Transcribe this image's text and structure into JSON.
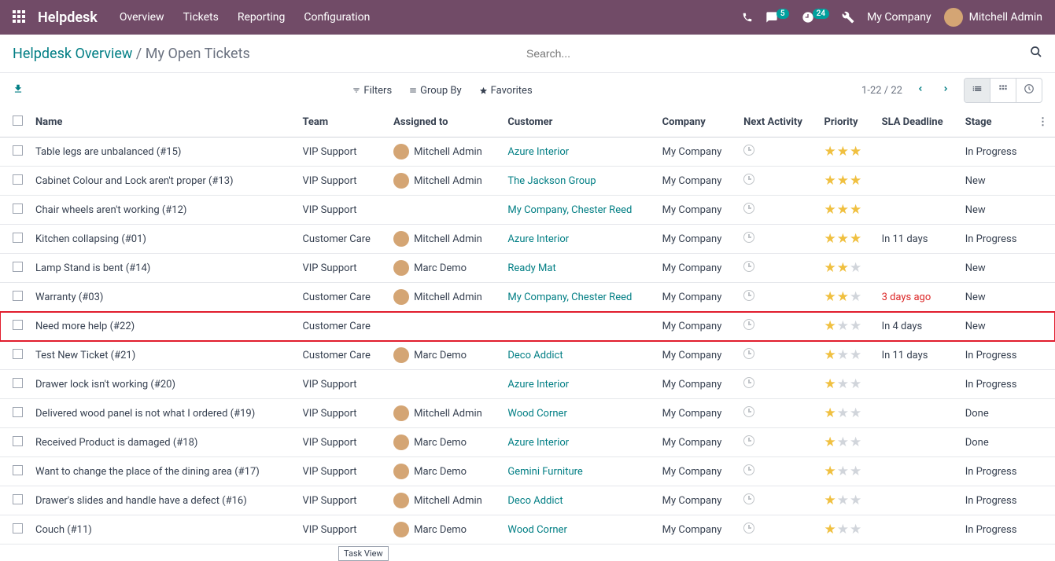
{
  "nav": {
    "brand": "Helpdesk",
    "menu": [
      "Overview",
      "Tickets",
      "Reporting",
      "Configuration"
    ],
    "chat_badge": "5",
    "activity_badge": "24",
    "company": "My Company",
    "user": "Mitchell Admin"
  },
  "breadcrumb": {
    "parent": "Helpdesk Overview",
    "current": "My Open Tickets"
  },
  "search": {
    "placeholder": "Search..."
  },
  "filters": {
    "filters": "Filters",
    "group_by": "Group By",
    "favorites": "Favorites"
  },
  "pager": {
    "text": "1-22 / 22"
  },
  "columns": [
    "Name",
    "Team",
    "Assigned to",
    "Customer",
    "Company",
    "Next Activity",
    "Priority",
    "SLA Deadline",
    "Stage"
  ],
  "tooltip": "Task View",
  "rows": [
    {
      "name": "Table legs are unbalanced (#15)",
      "team": "VIP Support",
      "assigned": "Mitchell Admin",
      "has_avatar": true,
      "customer": "Azure Interior",
      "company": "My Company",
      "priority": 3,
      "sla": "",
      "sla_overdue": false,
      "stage": "In Progress",
      "highlight": false
    },
    {
      "name": "Cabinet Colour and Lock aren't proper (#13)",
      "team": "VIP Support",
      "assigned": "Mitchell Admin",
      "has_avatar": true,
      "customer": "The Jackson Group",
      "company": "My Company",
      "priority": 3,
      "sla": "",
      "sla_overdue": false,
      "stage": "New",
      "highlight": false
    },
    {
      "name": "Chair wheels aren't working (#12)",
      "team": "VIP Support",
      "assigned": "",
      "has_avatar": false,
      "customer": "My Company, Chester Reed",
      "company": "My Company",
      "priority": 3,
      "sla": "",
      "sla_overdue": false,
      "stage": "New",
      "highlight": false
    },
    {
      "name": "Kitchen collapsing (#01)",
      "team": "Customer Care",
      "assigned": "Mitchell Admin",
      "has_avatar": true,
      "customer": "Azure Interior",
      "company": "My Company",
      "priority": 3,
      "sla": "In 11 days",
      "sla_overdue": false,
      "stage": "In Progress",
      "highlight": false
    },
    {
      "name": "Lamp Stand is bent (#14)",
      "team": "VIP Support",
      "assigned": "Marc Demo",
      "has_avatar": true,
      "customer": "Ready Mat",
      "company": "My Company",
      "priority": 2,
      "sla": "",
      "sla_overdue": false,
      "stage": "New",
      "highlight": false
    },
    {
      "name": "Warranty (#03)",
      "team": "Customer Care",
      "assigned": "Mitchell Admin",
      "has_avatar": true,
      "customer": "My Company, Chester Reed",
      "company": "My Company",
      "priority": 2,
      "sla": "3 days ago",
      "sla_overdue": true,
      "stage": "New",
      "highlight": false
    },
    {
      "name": "Need more help (#22)",
      "team": "Customer Care",
      "assigned": "",
      "has_avatar": false,
      "customer": "",
      "company": "My Company",
      "priority": 1,
      "sla": "In 4 days",
      "sla_overdue": false,
      "stage": "New",
      "highlight": true
    },
    {
      "name": "Test New Ticket (#21)",
      "team": "Customer Care",
      "assigned": "Marc Demo",
      "has_avatar": true,
      "customer": "Deco Addict",
      "company": "My Company",
      "priority": 1,
      "sla": "In 11 days",
      "sla_overdue": false,
      "stage": "In Progress",
      "highlight": false
    },
    {
      "name": "Drawer lock isn't working (#20)",
      "team": "VIP Support",
      "assigned": "",
      "has_avatar": false,
      "customer": "Azure Interior",
      "company": "My Company",
      "priority": 1,
      "sla": "",
      "sla_overdue": false,
      "stage": "In Progress",
      "highlight": false
    },
    {
      "name": "Delivered wood panel is not what I ordered (#19)",
      "team": "VIP Support",
      "assigned": "Mitchell Admin",
      "has_avatar": true,
      "customer": "Wood Corner",
      "company": "My Company",
      "priority": 1,
      "sla": "",
      "sla_overdue": false,
      "stage": "Done",
      "highlight": false
    },
    {
      "name": "Received Product is damaged (#18)",
      "team": "VIP Support",
      "assigned": "Marc Demo",
      "has_avatar": true,
      "customer": "Azure Interior",
      "company": "My Company",
      "priority": 1,
      "sla": "",
      "sla_overdue": false,
      "stage": "Done",
      "highlight": false
    },
    {
      "name": "Want to change the place of the dining area (#17)",
      "team": "VIP Support",
      "assigned": "Marc Demo",
      "has_avatar": true,
      "customer": "Gemini Furniture",
      "company": "My Company",
      "priority": 1,
      "sla": "",
      "sla_overdue": false,
      "stage": "In Progress",
      "highlight": false
    },
    {
      "name": "Drawer's slides and handle have a defect (#16)",
      "team": "VIP Support",
      "assigned": "Mitchell Admin",
      "has_avatar": true,
      "customer": "Deco Addict",
      "company": "My Company",
      "priority": 1,
      "sla": "",
      "sla_overdue": false,
      "stage": "In Progress",
      "highlight": false
    },
    {
      "name": "Couch (#11)",
      "team": "VIP Support",
      "assigned": "Marc Demo",
      "has_avatar": true,
      "customer": "Wood Corner",
      "company": "My Company",
      "priority": 1,
      "sla": "",
      "sla_overdue": false,
      "stage": "In Progress",
      "highlight": false
    }
  ]
}
